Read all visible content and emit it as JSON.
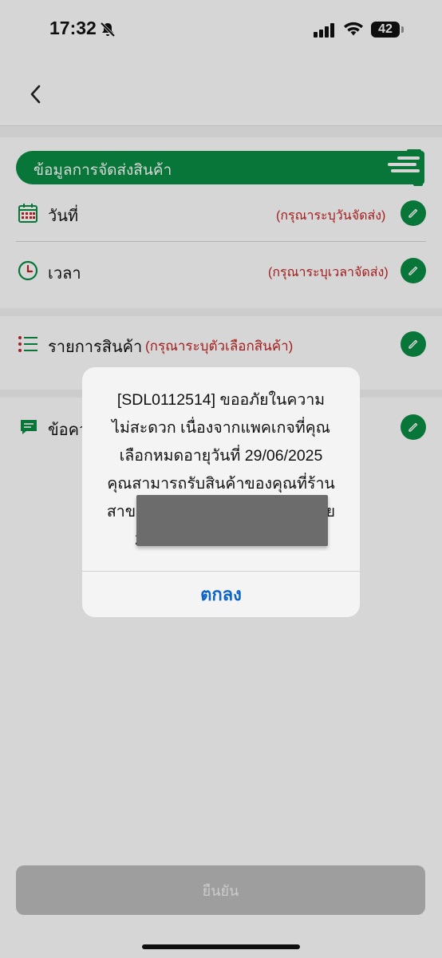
{
  "status_bar": {
    "time": "17:32",
    "battery": "42",
    "icons": [
      "bell-off-icon",
      "cellular-signal-icon",
      "wifi-icon",
      "battery-icon"
    ]
  },
  "header": {
    "back_icon": "chevron-left-icon"
  },
  "delivery": {
    "banner_title": "ข้อมูลการจัดส่งสินค้า",
    "date_label": "วันที่",
    "date_hint": "(กรุณาระบุวันจัดส่ง)",
    "time_label": "เวลา",
    "time_hint": "(กรุณาระบุเวลาจัดส่ง)"
  },
  "products": {
    "label": "รายการสินค้า",
    "hint": "(กรุณาระบุตัวเลือกสินค้า)"
  },
  "message": {
    "label_visible": "ข้อคว"
  },
  "alert": {
    "message_lines": [
      "[SDL0112514] ขออภัยในความ",
      "ไม่สะดวก เนื่องจากแพคเกจที่คุณ",
      "เลือกหมดอายุวันที่ 29/06/2025",
      "คุณสามารถรับสินค้าของคุณที่ร้าน",
      "สาขา                                        าย",
      "2"
    ],
    "ok_label": "ตกลง"
  },
  "footer": {
    "confirm_label": "ยืนยัน"
  },
  "colors": {
    "brand_green": "#0a8d45",
    "hint_red": "#c42222",
    "link_blue": "#0a64c8",
    "disabled_button": "#bdbdbd"
  }
}
